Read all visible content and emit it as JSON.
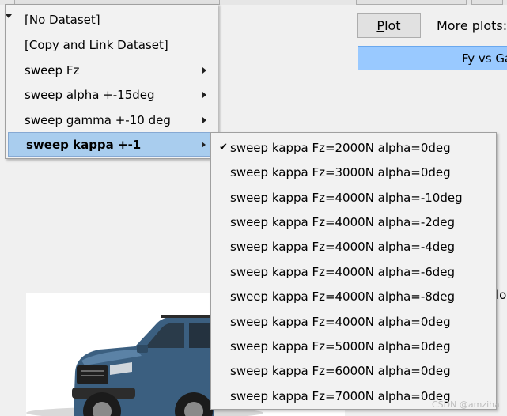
{
  "background": {
    "plot_button_label": "Plot",
    "more_plots_label": "More plots:",
    "more_plots_selected": "Fy vs Ga",
    "clipped_text": "lo"
  },
  "menu": {
    "items": [
      {
        "label": "[No Dataset]",
        "has_submenu": false
      },
      {
        "label": "[Copy and Link Dataset]",
        "has_submenu": false
      },
      {
        "label": "sweep Fz",
        "has_submenu": true
      },
      {
        "label": "sweep alpha +-15deg",
        "has_submenu": true
      },
      {
        "label": "sweep gamma +-10 deg",
        "has_submenu": true
      },
      {
        "label": "sweep kappa +-1",
        "has_submenu": true,
        "active": true
      }
    ]
  },
  "submenu": {
    "checked_index": 0,
    "items": [
      "sweep kappa Fz=2000N alpha=0deg",
      "sweep kappa Fz=3000N alpha=0deg",
      "sweep kappa Fz=4000N alpha=-10deg",
      "sweep kappa Fz=4000N alpha=-2deg",
      "sweep kappa Fz=4000N alpha=-4deg",
      "sweep kappa Fz=4000N alpha=-6deg",
      "sweep kappa Fz=4000N alpha=-8deg",
      "sweep kappa Fz=4000N alpha=0deg",
      "sweep kappa Fz=5000N alpha=0deg",
      "sweep kappa Fz=6000N alpha=0deg",
      "sweep kappa Fz=7000N alpha=0deg"
    ]
  },
  "watermark": "CSDN @amziha",
  "colors": {
    "menu_highlight": "#a9cdee",
    "selected_bar": "#99c9ff"
  }
}
